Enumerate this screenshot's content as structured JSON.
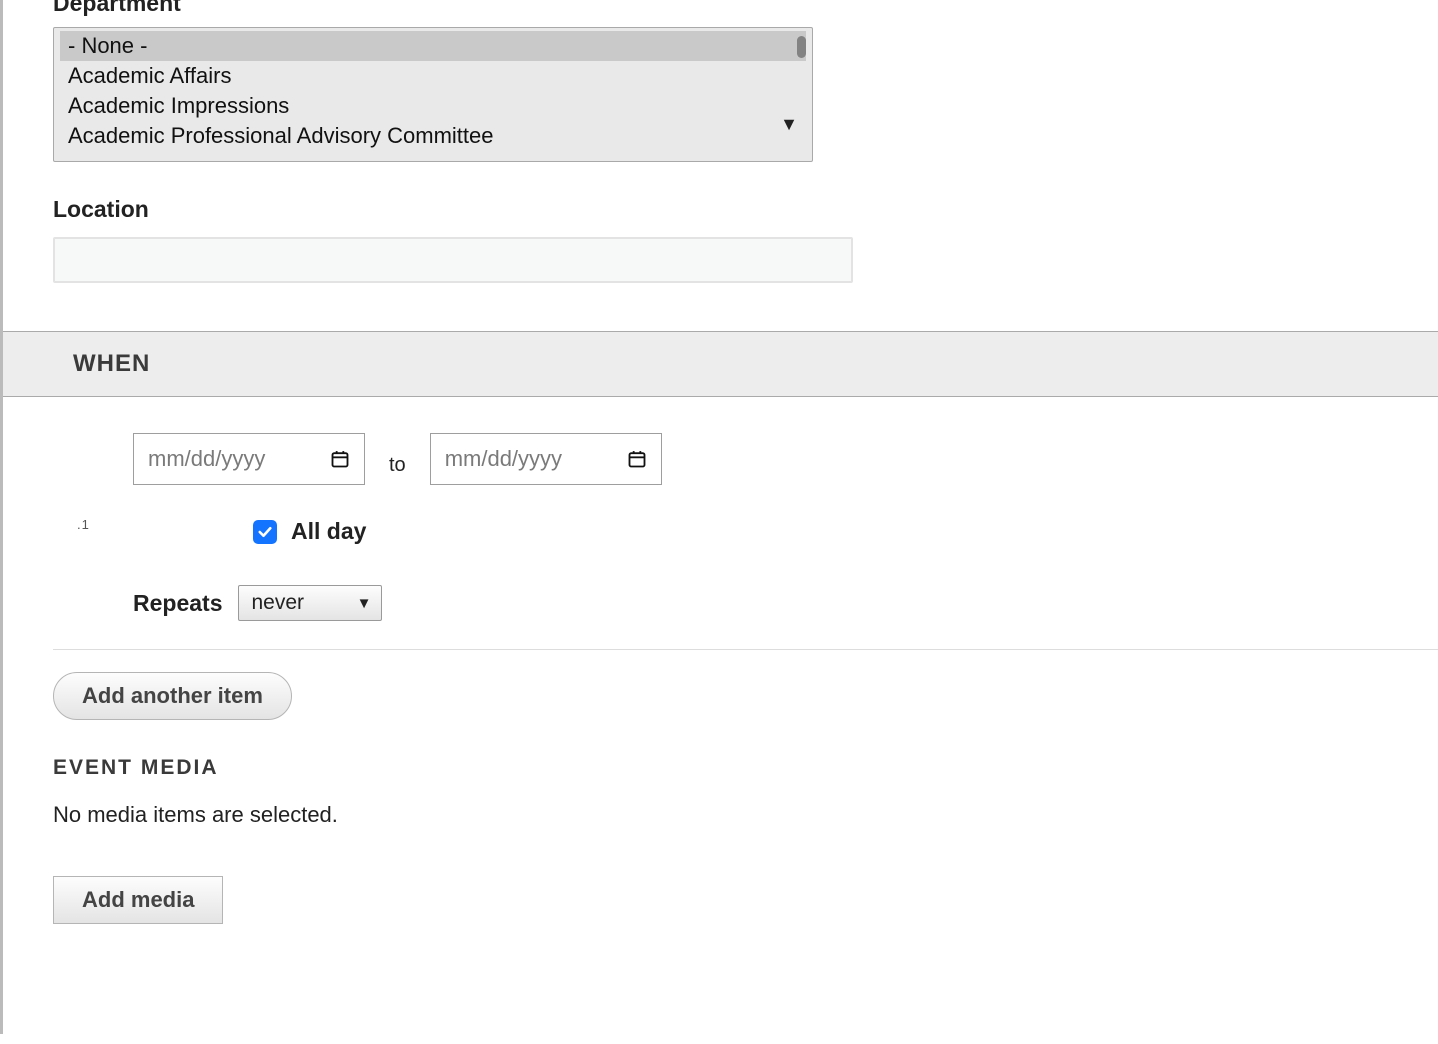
{
  "department": {
    "label": "Department",
    "options": [
      "- None -",
      "Academic Affairs",
      "Academic Impressions",
      "Academic Professional Advisory Committee"
    ],
    "selected_index": 0
  },
  "location": {
    "label": "Location",
    "value": ""
  },
  "when": {
    "section_title": "WHEN",
    "date_placeholder": "mm/dd/yyyy",
    "to_label": "to",
    "all_day_label": "All day",
    "all_day_checked": true,
    "repeats_label": "Repeats",
    "repeats_value": "never",
    "marker": ".1"
  },
  "buttons": {
    "add_another": "Add another item",
    "add_media": "Add media"
  },
  "event_media": {
    "heading": "EVENT MEDIA",
    "empty_text": "No media items are selected."
  }
}
